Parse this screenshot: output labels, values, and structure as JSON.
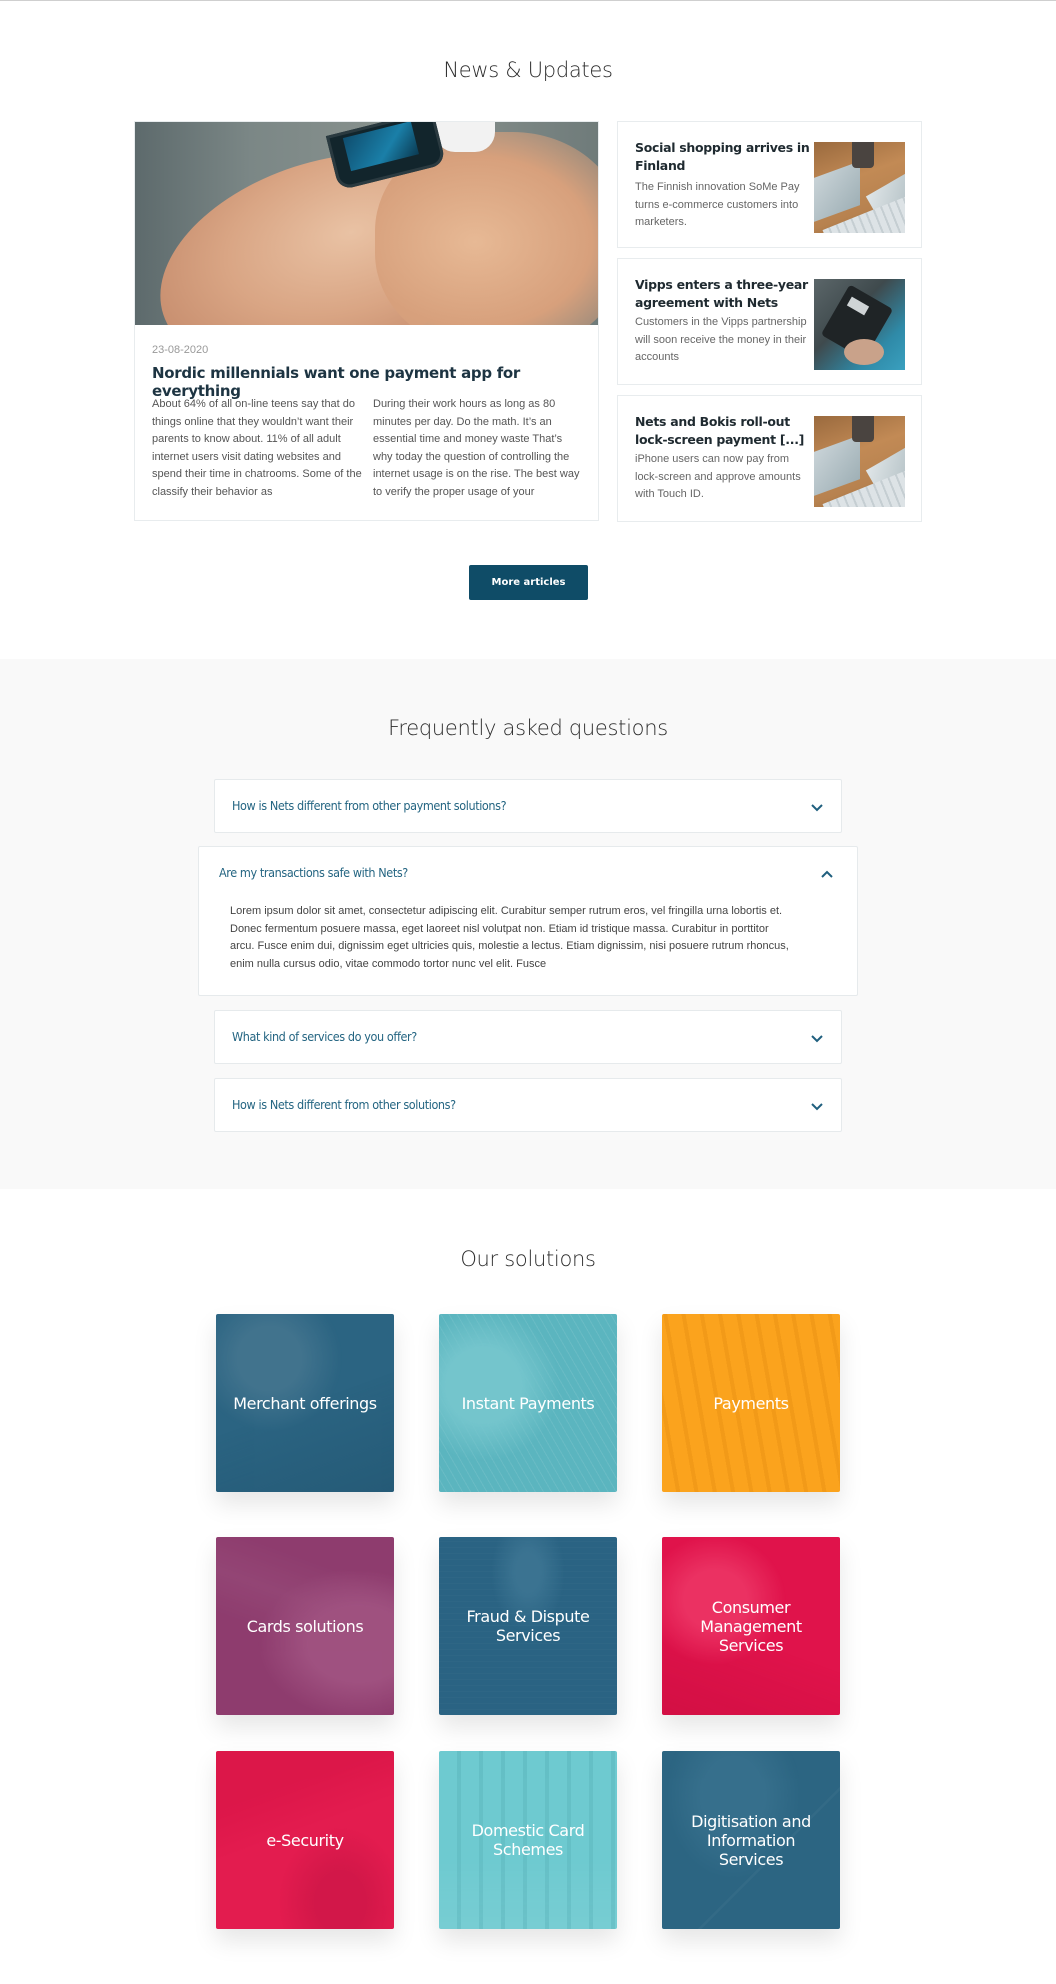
{
  "news": {
    "title": "News & Updates",
    "featured": {
      "date": "23-08-2020",
      "title": "Nordic millennials want one payment app for everything",
      "col1": "About 64% of all on-line teens say that do things online that they wouldn’t want their parents to know about.  11% of all adult internet users visit dating websites and spend their time in chatrooms. Some of the classify their behavior as",
      "col2": "During their work hours as long as 80 minutes per day. Do the math. It’s an essential time and money waste  That’s why today the question of controlling the internet usage is on the rise. The best way to verify the proper usage of your"
    },
    "articles": [
      {
        "title": "Social shopping arrives in Finland",
        "desc": "The Finnish innovation SoMe Pay turns e-commerce customers into marketers.",
        "image": "desk-laptop-photo"
      },
      {
        "title": "Vipps enters a three-year agreement with Nets",
        "desc": "Customers in the Vipps partnership will soon receive the money in their accounts",
        "image": "card-terminal-photo"
      },
      {
        "title": "Nets and Bokis roll-out lock-screen payment [...]",
        "desc": "iPhone users can now pay from lock-screen and approve amounts with Touch ID.",
        "image": "desk-laptop-photo"
      }
    ],
    "more_button": "More articles"
  },
  "faq": {
    "title": "Frequently asked questions",
    "items": [
      {
        "question": "How is Nets different from other payment solutions?",
        "expanded": false
      },
      {
        "question": "Are my transactions safe with Nets?",
        "expanded": true,
        "answer": "Lorem ipsum dolor sit amet, consectetur adipiscing elit. Curabitur semper rutrum eros, vel fringilla urna lobortis et. Donec fermentum posuere massa, eget laoreet nisl volutpat non. Etiam id tristique massa. Curabitur in porttitor arcu. Fusce enim dui, dignissim eget ultricies quis, molestie a lectus. Etiam dignissim, nisi posuere rutrum rhoncus, enim nulla cursus odio, vitae commodo tortor nunc vel elit. Fusce"
      },
      {
        "question": "What kind of services do you offer?",
        "expanded": false
      },
      {
        "question": "How is Nets different from other solutions?",
        "expanded": false
      }
    ]
  },
  "solutions": {
    "title": "Our solutions",
    "tiles": [
      {
        "label": "Merchant offerings",
        "color": "#2b6482"
      },
      {
        "label": "Instant Payments",
        "color": "#5bb5bf"
      },
      {
        "label": "Payments",
        "color": "#fba31d"
      },
      {
        "label": "Cards solutions",
        "color": "#8e3c6e"
      },
      {
        "label": "Fraud & Dispute Services",
        "color": "#2a6383"
      },
      {
        "label": "Consumer Management Services",
        "color": "#e0134b"
      },
      {
        "label": "e-Security",
        "color": "#e31c4f"
      },
      {
        "label": "Domestic Card Schemes",
        "color": "#6ecad0"
      },
      {
        "label": "Digitisation and Information Services",
        "color": "#2c6582"
      }
    ]
  },
  "colors": {
    "brand_dark": "#0f4c67",
    "faq_text": "#246582",
    "faq_bg": "#f9f9f9"
  }
}
